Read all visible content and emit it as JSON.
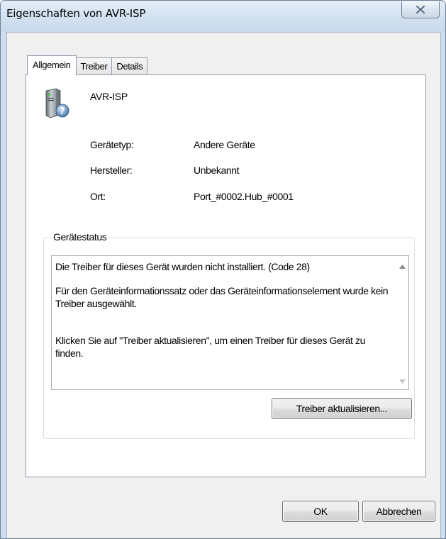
{
  "window": {
    "title": "Eigenschaften von AVR-ISP",
    "close_icon": "close-icon"
  },
  "tabs": [
    {
      "label": "Allgemein",
      "active": true
    },
    {
      "label": "Treiber",
      "active": false
    },
    {
      "label": "Details",
      "active": false
    }
  ],
  "device": {
    "icon": "unknown-device-icon",
    "name": "AVR-ISP"
  },
  "properties": [
    {
      "label": "Gerätetyp:",
      "value": "Andere Geräte"
    },
    {
      "label": "Hersteller:",
      "value": "Unbekannt"
    },
    {
      "label": "Ort:",
      "value": "Port_#0002.Hub_#0001"
    }
  ],
  "status": {
    "legend": "Gerätestatus",
    "line1": "Die Treiber für dieses Gerät wurden nicht installiert. (Code 28)",
    "line2": "Für den Geräteinformationssatz oder das Geräteinformationselement wurde kein Treiber ausgewählt.",
    "line3": "Klicken Sie auf \"Treiber aktualisieren\", um einen Treiber für dieses Gerät zu finden.",
    "update_button": "Treiber aktualisieren..."
  },
  "footer": {
    "ok_label": "OK",
    "cancel_label": "Abbrechen"
  },
  "colors": {
    "frame": "#cfdeee",
    "panel": "#f0f0f0",
    "content": "#ffffff"
  }
}
